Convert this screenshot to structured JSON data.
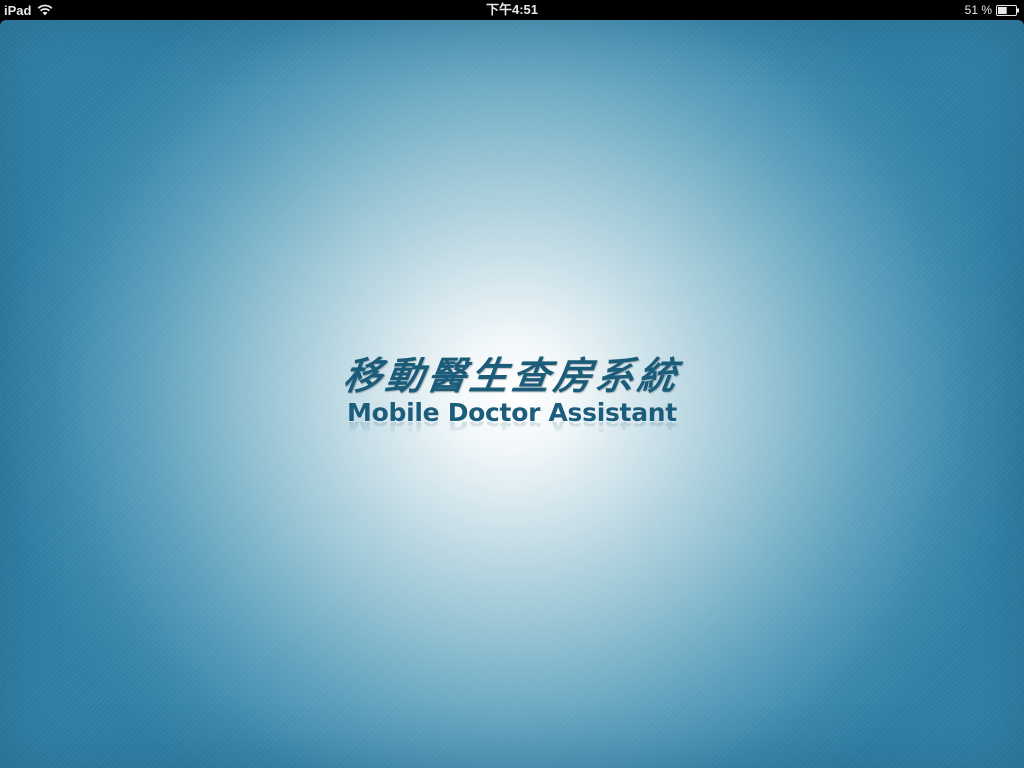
{
  "status_bar": {
    "device": "iPad",
    "time": "下午4:51",
    "battery_percent": "51 %",
    "battery_level": 0.51,
    "icons": {
      "wifi": "wifi-icon",
      "battery": "battery-icon"
    }
  },
  "splash": {
    "title_cn": "移動醫生查房系統",
    "title_en": "Mobile Doctor Assistant"
  },
  "colors": {
    "background_edge": "#2f7fa4",
    "background_center": "#ffffff",
    "logo_text": "#1c5d7c",
    "status_bar": "#000000"
  }
}
